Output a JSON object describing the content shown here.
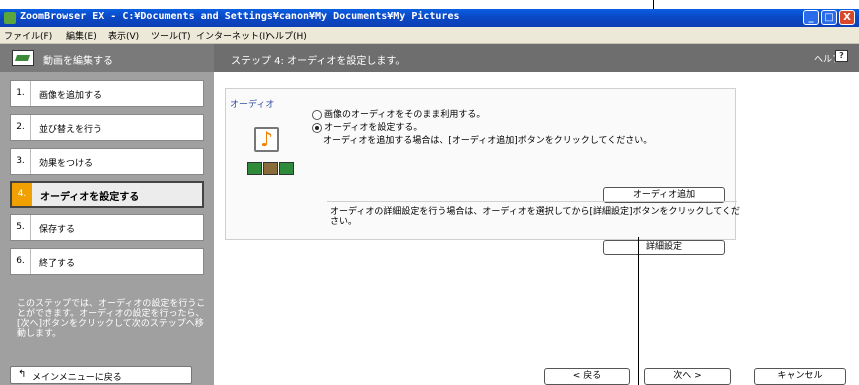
{
  "window": {
    "title": "ZoomBrowser EX - C:¥Documents and Settings¥canon¥My Documents¥My Pictures",
    "buttons": {
      "minimize": "_",
      "maximize": "□",
      "close": "X"
    }
  },
  "menubar": [
    "ファイル(F)",
    "編集(E)",
    "表示(V)",
    "ツール(T)",
    "インターネット(I)",
    "ヘルプ(H)"
  ],
  "left_panel": {
    "title": "動画を編集する",
    "steps": [
      {
        "num": "1.",
        "label": "画像を追加する"
      },
      {
        "num": "2.",
        "label": "並び替えを行う"
      },
      {
        "num": "3.",
        "label": "効果をつける"
      },
      {
        "num": "4.",
        "label": "オーディオを設定する"
      },
      {
        "num": "5.",
        "label": "保存する"
      },
      {
        "num": "6.",
        "label": "終了する"
      }
    ],
    "description": "このステップでは、オーディオの設定を行うことができます。オーディオの設定を行ったら、[次へ]ボタンをクリックして次のステップへ移動します。",
    "main_menu_button": "メインメニューに戻る",
    "main_menu_icon": "↰"
  },
  "right_panel": {
    "title": "ステップ 4: オーディオを設定します。",
    "help_label": "ヘルプ",
    "help_icon": "?",
    "audio_section_label": "オーディオ",
    "note_glyph": "♪",
    "option_keep": "画像のオーディオをそのまま利用する。",
    "option_set": "オーディオを設定する。",
    "option_set_desc": "オーディオを追加する場合は、[オーディオ追加]ボタンをクリックしてください。",
    "add_audio_button": "オーディオ追加",
    "detail_text": "オーディオの詳細設定を行う場合は、オーディオを選択してから[詳細設定]ボタンをクリックしてください。",
    "detail_button": "詳細設定",
    "back_button": "< 戻る",
    "next_button": "次へ >",
    "cancel_button": "キャンセル"
  }
}
